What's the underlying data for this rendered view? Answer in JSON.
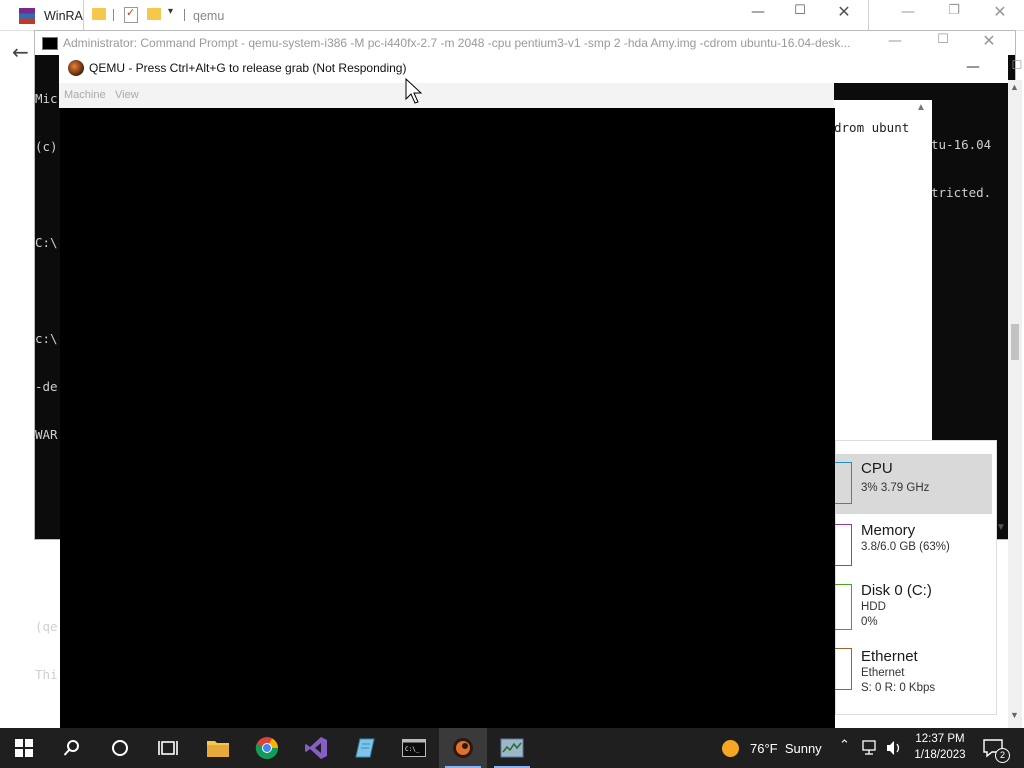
{
  "winrar": {
    "title_short": "WinRAR"
  },
  "explorer": {
    "path_text": "qemu"
  },
  "cmd": {
    "title": "Administrator:  Command Prompt - qemu-system-i386  -M pc-i440fx-2.7 -m 2048 -cpu pentium3-v1 -smp 2 -hda Amy.img -cdrom ubuntu-16.04-desk...",
    "left_lines": [
      "Mic",
      "(c)",
      "",
      "C:\\",
      "",
      "c:\\",
      "-de",
      "WAR",
      "",
      "",
      "",
      "(qe",
      "Thi"
    ],
    "right_line_1": "drom ubunt",
    "right_line_2": "tu-16.04",
    "right_line_3": "tricted."
  },
  "qemu": {
    "title": "QEMU - Press Ctrl+Alt+G to release grab (Not Responding)",
    "menu": [
      "Machine",
      "View"
    ]
  },
  "task_manager": {
    "items": [
      {
        "title": "CPU",
        "line1": "3% 3.79 GHz",
        "line2": ""
      },
      {
        "title": "Memory",
        "line1": "3.8/6.0 GB (63%)",
        "line2": ""
      },
      {
        "title": "Disk 0 (C:)",
        "line1": "HDD",
        "line2": "0%"
      },
      {
        "title": "Ethernet",
        "line1": "Ethernet",
        "line2": "S: 0 R: 0 Kbps"
      }
    ],
    "colors": {
      "cpu": "#1e90c8",
      "memory": "#8b3fb3",
      "disk": "#4da61a",
      "ethernet": "#a0622d",
      "selected": "#d9d9d9"
    }
  },
  "taskbar": {
    "weather": "76°F  Sunny",
    "time": "12:37 PM",
    "date": "1/18/2023",
    "notification_count": "2",
    "icons": [
      "windows-start-icon",
      "search-icon",
      "cortana-icon",
      "task-view-icon",
      "file-explorer-icon",
      "chrome-icon",
      "visual-studio-icon",
      "notepad-icon",
      "command-prompt-icon",
      "qemu-icon",
      "task-manager-icon"
    ]
  }
}
